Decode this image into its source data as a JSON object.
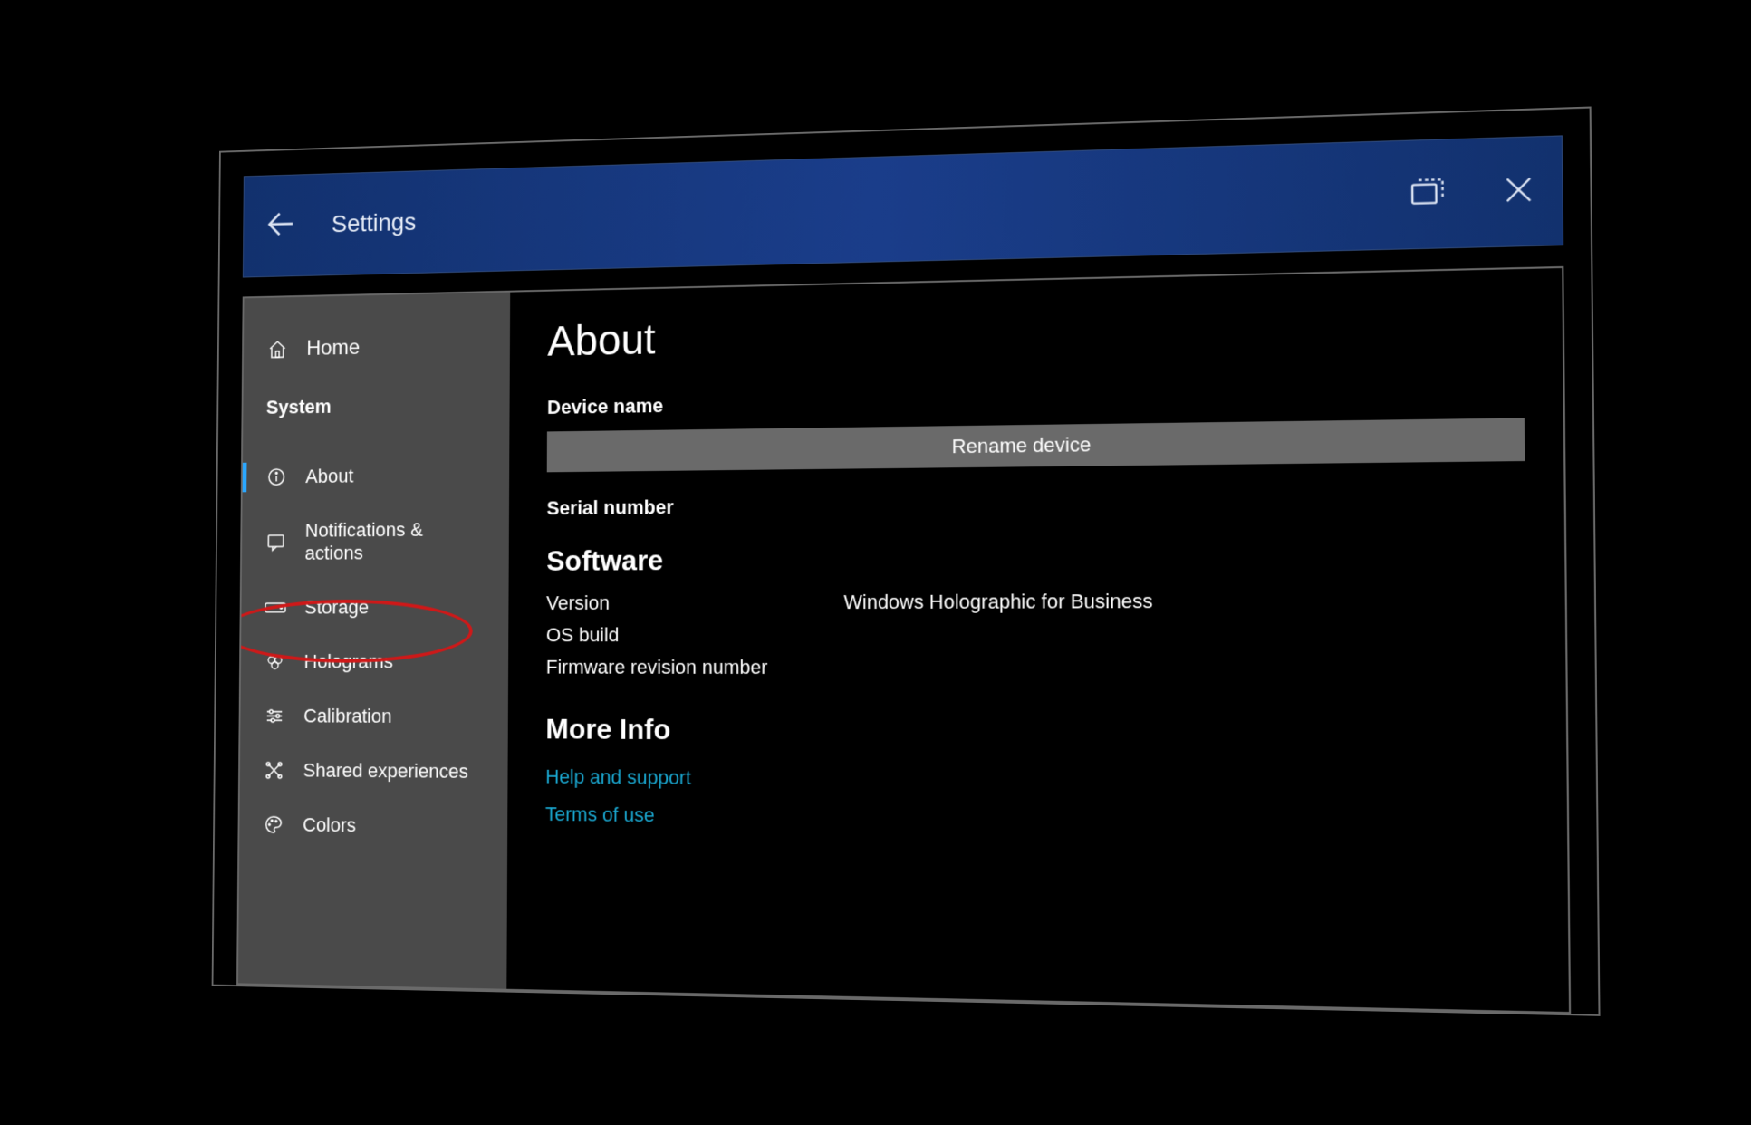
{
  "titlebar": {
    "title": "Settings"
  },
  "sidebar": {
    "home_label": "Home",
    "section_label": "System",
    "items": [
      {
        "label": "About",
        "icon": "info-icon",
        "active": true
      },
      {
        "label": "Notifications & actions",
        "icon": "chat-icon",
        "active": false
      },
      {
        "label": "Storage",
        "icon": "storage-icon",
        "active": false
      },
      {
        "label": "Holograms",
        "icon": "holograms-icon",
        "active": false
      },
      {
        "label": "Calibration",
        "icon": "sliders-icon",
        "active": false
      },
      {
        "label": "Shared experiences",
        "icon": "crossed-tools-icon",
        "active": false
      },
      {
        "label": "Colors",
        "icon": "palette-icon",
        "active": false
      }
    ]
  },
  "main": {
    "page_title": "About",
    "device_name_label": "Device name",
    "rename_button": "Rename device",
    "serial_label": "Serial number",
    "software_heading": "Software",
    "version_label": "Version",
    "version_value": "Windows Holographic for Business",
    "os_build_label": "OS build",
    "firmware_label": "Firmware revision number",
    "more_info_heading": "More Info",
    "help_link": "Help and support",
    "terms_link": "Terms of use"
  },
  "annotation": {
    "highlighted_item": "Storage"
  }
}
